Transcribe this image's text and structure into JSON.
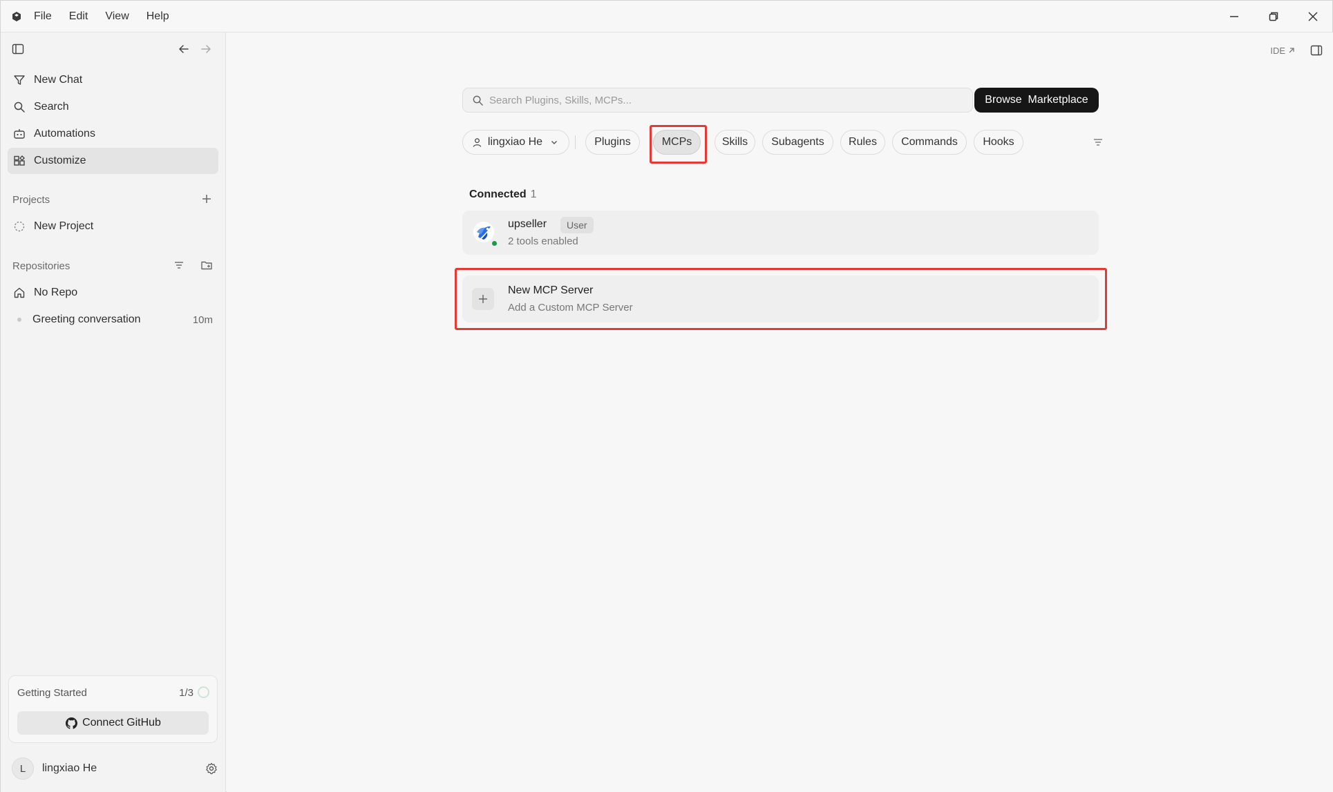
{
  "menu": [
    "File",
    "Edit",
    "View",
    "Help"
  ],
  "sidebar": {
    "nav": [
      {
        "label": "New Chat",
        "icon": "new-chat-icon"
      },
      {
        "label": "Search",
        "icon": "search-icon"
      },
      {
        "label": "Automations",
        "icon": "automations-icon"
      },
      {
        "label": "Customize",
        "icon": "customize-icon",
        "active": true
      }
    ],
    "projects_label": "Projects",
    "new_project": "New Project",
    "repositories_label": "Repositories",
    "no_repo": "No Repo",
    "conversation": {
      "title": "Greeting conversation",
      "time": "10m"
    },
    "getting_started": {
      "title": "Getting Started",
      "progress": "1/3",
      "button": "Connect GitHub"
    },
    "user": {
      "initial": "L",
      "name": "lingxiao He"
    }
  },
  "main": {
    "ide_link": "IDE",
    "search_placeholder": "Search Plugins, Skills, MCPs...",
    "browse_button": "Browse  Marketplace",
    "user_filter": "lingxiao He",
    "tabs": [
      "Plugins",
      "MCPs",
      "Skills",
      "Subagents",
      "Rules",
      "Commands",
      "Hooks"
    ],
    "active_tab": "MCPs",
    "connected_label": "Connected",
    "connected_count": "1",
    "server": {
      "name": "upseller",
      "badge": "User",
      "subtitle": "2 tools enabled",
      "status_color": "#1a9a4a"
    },
    "new_server": {
      "title": "New MCP Server",
      "subtitle": "Add a Custom MCP Server"
    }
  },
  "colors": {
    "highlight": "#e53935",
    "primary_button": "#161616"
  }
}
